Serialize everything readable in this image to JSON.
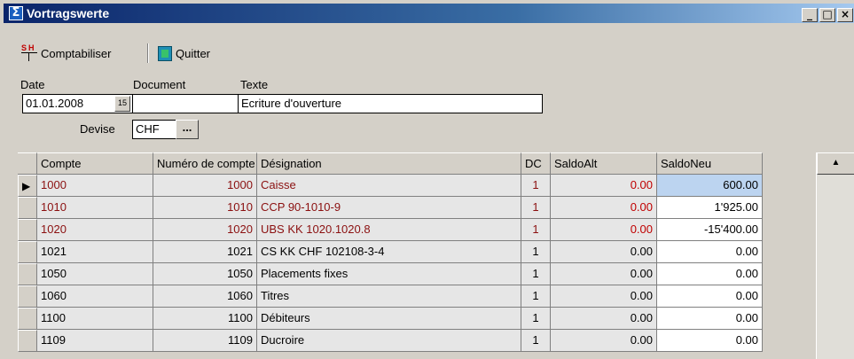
{
  "window": {
    "title": "Vortragswerte",
    "icon": "sigma-icon"
  },
  "titlebar_buttons": {
    "minimize": "_",
    "maximize": "□",
    "close": "×"
  },
  "toolbar": {
    "comptabiliser_label": "Comptabiliser",
    "comptabiliser_icon_s": "S",
    "comptabiliser_icon_h": "H",
    "quitter_label": "Quitter"
  },
  "form": {
    "date_label": "Date",
    "document_label": "Document",
    "texte_label": "Texte",
    "date_value": "01.01.2008",
    "calendar_icon_text": "15",
    "document_value": "",
    "texte_value": "Ecriture d'ouverture",
    "devise_label": "Devise",
    "devise_value": "CHF",
    "devise_button": "..."
  },
  "grid": {
    "columns": [
      "Compte",
      "Numéro de compte",
      "Désignation",
      "DC",
      "SaldoAlt",
      "SaldoNeu"
    ],
    "selected_pointer": "▶",
    "rows": [
      {
        "compte": "1000",
        "numero": "1000",
        "designation": "Caisse",
        "dc": "1",
        "saldo_alt": "0.00",
        "saldo_neu": "600.00"
      },
      {
        "compte": "1010",
        "numero": "1010",
        "designation": "CCP 90-1010-9",
        "dc": "1",
        "saldo_alt": "0.00",
        "saldo_neu": "1'925.00"
      },
      {
        "compte": "1020",
        "numero": "1020",
        "designation": "UBS KK 1020.1020.8",
        "dc": "1",
        "saldo_alt": "0.00",
        "saldo_neu": "-15'400.00"
      },
      {
        "compte": "1021",
        "numero": "1021",
        "designation": "CS KK CHF 102108-3-4",
        "dc": "1",
        "saldo_alt": "0.00",
        "saldo_neu": "0.00"
      },
      {
        "compte": "1050",
        "numero": "1050",
        "designation": "Placements fixes",
        "dc": "1",
        "saldo_alt": "0.00",
        "saldo_neu": "0.00"
      },
      {
        "compte": "1060",
        "numero": "1060",
        "designation": "Titres",
        "dc": "1",
        "saldo_alt": "0.00",
        "saldo_neu": "0.00"
      },
      {
        "compte": "1100",
        "numero": "1100",
        "designation": "Débiteurs",
        "dc": "1",
        "saldo_alt": "0.00",
        "saldo_neu": "0.00"
      },
      {
        "compte": "1109",
        "numero": "1109",
        "designation": "Ducroire",
        "dc": "1",
        "saldo_alt": "0.00",
        "saldo_neu": "0.00"
      }
    ]
  },
  "scrollbar": {
    "up_arrow": "▲"
  },
  "colors": {
    "title_bar": "#0a246a",
    "changed_row_text": "#8b1010",
    "selected_cell": "#bcd4f0"
  }
}
